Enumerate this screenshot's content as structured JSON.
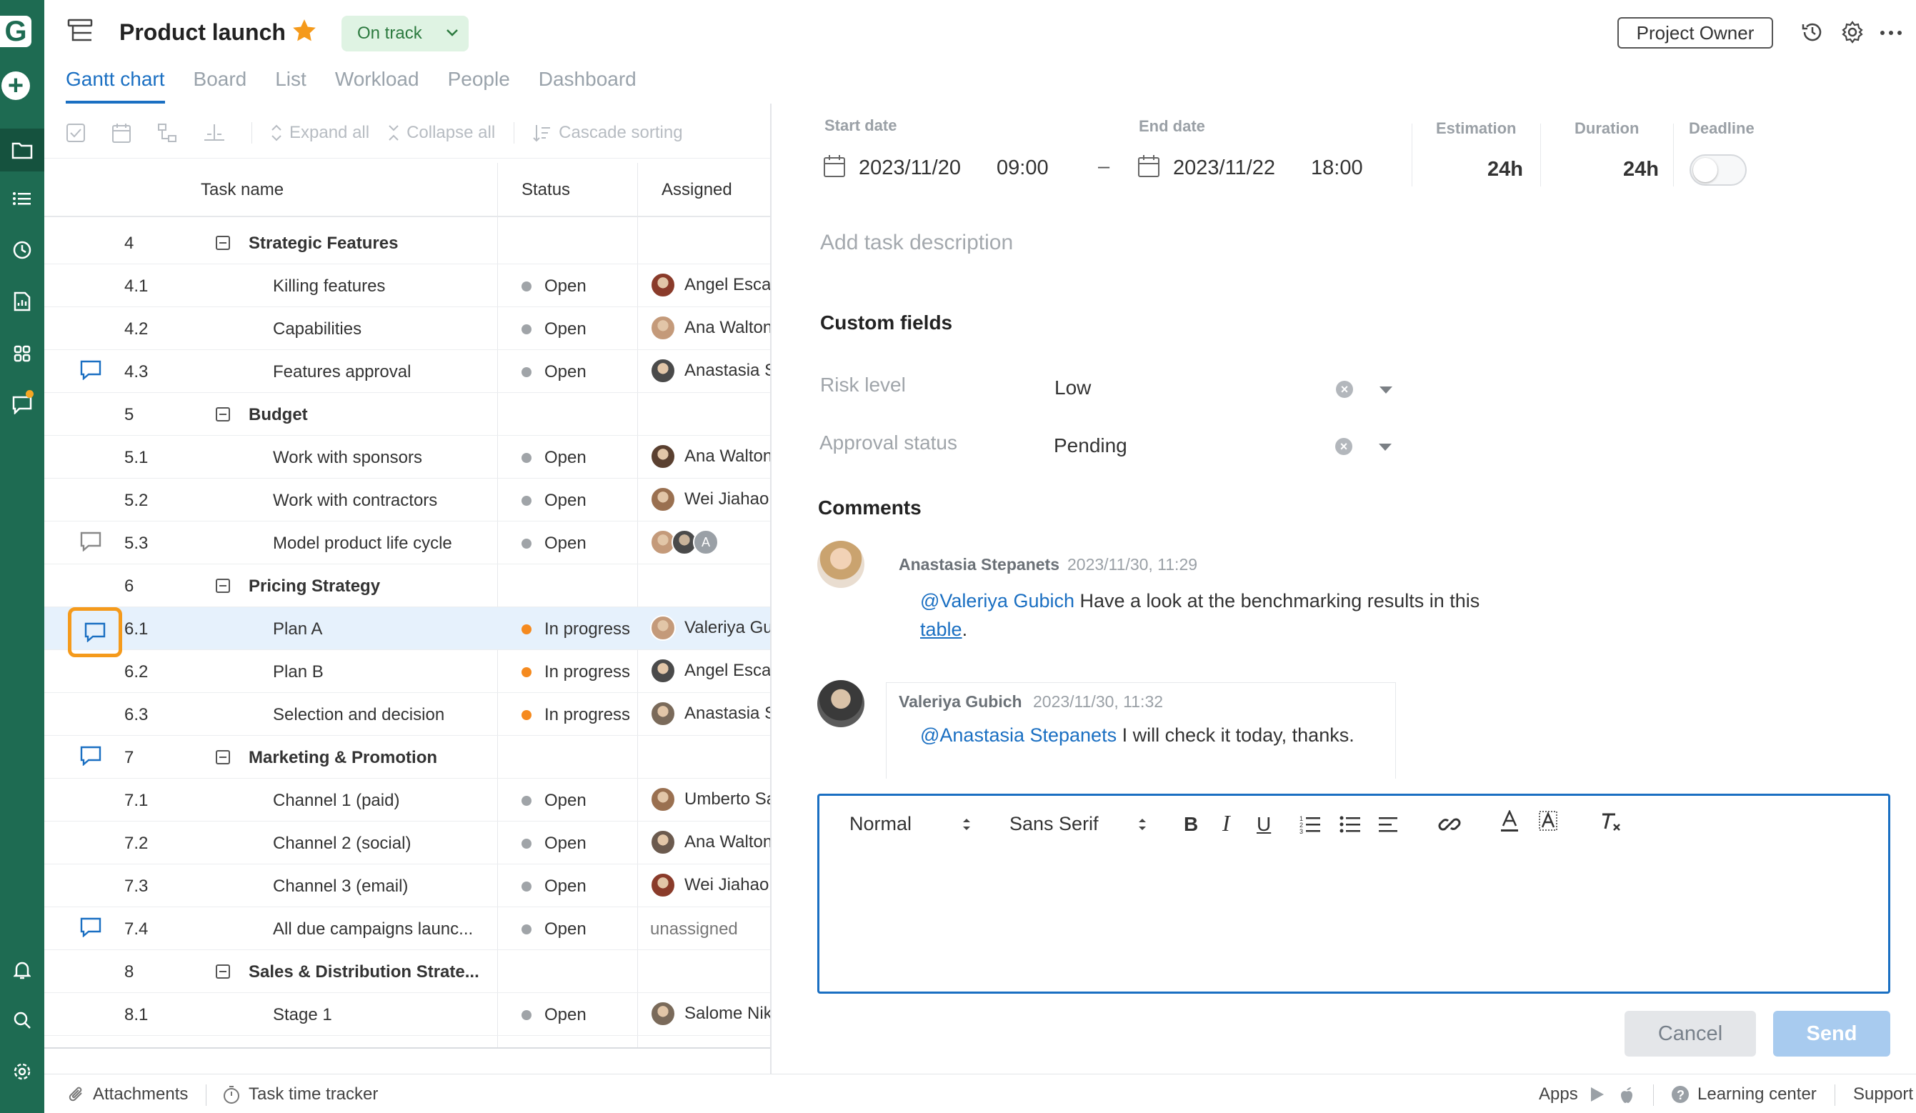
{
  "app": {
    "logo_letter": "G",
    "project_title": "Product launch",
    "project_status": "On track",
    "role_button": "Project Owner",
    "colors": {
      "rail": "#1e6b52",
      "accent": "#1a6fc2",
      "status_open": "#a0a4a8",
      "status_in_progress": "#f58a1f",
      "highlight": "#f59a1b"
    }
  },
  "tabs": [
    {
      "label": "Gantt chart",
      "active": true
    },
    {
      "label": "Board"
    },
    {
      "label": "List"
    },
    {
      "label": "Workload"
    },
    {
      "label": "People"
    },
    {
      "label": "Dashboard"
    }
  ],
  "toolbar": {
    "expand_all": "Expand all",
    "collapse_all": "Collapse all",
    "cascade_sorting": "Cascade sorting"
  },
  "table": {
    "headers": {
      "task_name": "Task name",
      "status": "Status",
      "assigned": "Assigned"
    },
    "rows": [
      {
        "num": "4",
        "name": "Strategic Features",
        "group": true
      },
      {
        "num": "4.1",
        "name": "Killing features",
        "status": "Open",
        "assignee": "Angel Escaj"
      },
      {
        "num": "4.2",
        "name": "Capabilities",
        "status": "Open",
        "assignee": "Ana Walton"
      },
      {
        "num": "4.3",
        "name": "Features approval",
        "status": "Open",
        "assignee": "Anastasia S",
        "comment": true
      },
      {
        "num": "5",
        "name": "Budget",
        "group": true
      },
      {
        "num": "5.1",
        "name": "Work with sponsors",
        "status": "Open",
        "assignee": "Ana Walton"
      },
      {
        "num": "5.2",
        "name": "Work with contractors",
        "status": "Open",
        "assignee": "Wei Jiahao"
      },
      {
        "num": "5.3",
        "name": "Model product life cycle",
        "status": "Open",
        "multi": true,
        "comment": true,
        "comment_muted": true,
        "extra_initial": "A"
      },
      {
        "num": "6",
        "name": "Pricing Strategy",
        "group": true
      },
      {
        "num": "6.1",
        "name": "Plan A",
        "status": "In progress",
        "assignee": "Valeriya Gu",
        "comment": true,
        "selected": true
      },
      {
        "num": "6.2",
        "name": "Plan B",
        "status": "In progress",
        "assignee": "Angel Escaj"
      },
      {
        "num": "6.3",
        "name": "Selection and decision",
        "status": "In progress",
        "assignee": "Anastasia S"
      },
      {
        "num": "7",
        "name": "Marketing & Promotion",
        "group": true,
        "comment": true
      },
      {
        "num": "7.1",
        "name": "Channel 1 (paid)",
        "status": "Open",
        "assignee": "Umberto Sa"
      },
      {
        "num": "7.2",
        "name": "Channel 2 (social)",
        "status": "Open",
        "assignee": "Ana Walton"
      },
      {
        "num": "7.3",
        "name": "Channel 3 (email)",
        "status": "Open",
        "assignee": "Wei Jiahao"
      },
      {
        "num": "7.4",
        "name": "All due campaigns launc...",
        "status": "Open",
        "unassigned": "unassigned",
        "comment": true
      },
      {
        "num": "8",
        "name": "Sales & Distribution Strate...",
        "group": true
      },
      {
        "num": "8.1",
        "name": "Stage 1",
        "status": "Open",
        "assignee": "Salome Nik"
      }
    ]
  },
  "details": {
    "start_date_label": "Start date",
    "end_date_label": "End date",
    "estimation_label": "Estimation",
    "duration_label": "Duration",
    "deadline_label": "Deadline",
    "start_date": "2023/11/20",
    "start_time": "09:00",
    "dash": "–",
    "end_date": "2023/11/22",
    "end_time": "18:00",
    "estimation": "24h",
    "duration": "24h",
    "deadline_enabled": false,
    "description_placeholder": "Add task description",
    "custom_fields_title": "Custom fields",
    "custom_fields": [
      {
        "label": "Risk level",
        "value": "Low"
      },
      {
        "label": "Approval status",
        "value": "Pending"
      }
    ],
    "comments_title": "Comments",
    "comments": [
      {
        "author": "Anastasia Stepanets",
        "time": "2023/11/30, 11:29",
        "mention": "@Valeriya Gubich",
        "text": " Have a look at the benchmarking results in this",
        "link": "table",
        "after_link": "."
      },
      {
        "author": "Valeriya Gubich",
        "time": "2023/11/30, 11:32",
        "mention": "@Anastasia Stepanets",
        "text": " I will check it today, thanks."
      }
    ],
    "editor": {
      "paragraph_style": "Normal",
      "font": "Sans Serif"
    },
    "cancel_label": "Cancel",
    "send_label": "Send"
  },
  "footer": {
    "attachments": "Attachments",
    "time_tracker": "Task time tracker",
    "apps": "Apps",
    "learning_center": "Learning center",
    "support": "Support"
  }
}
